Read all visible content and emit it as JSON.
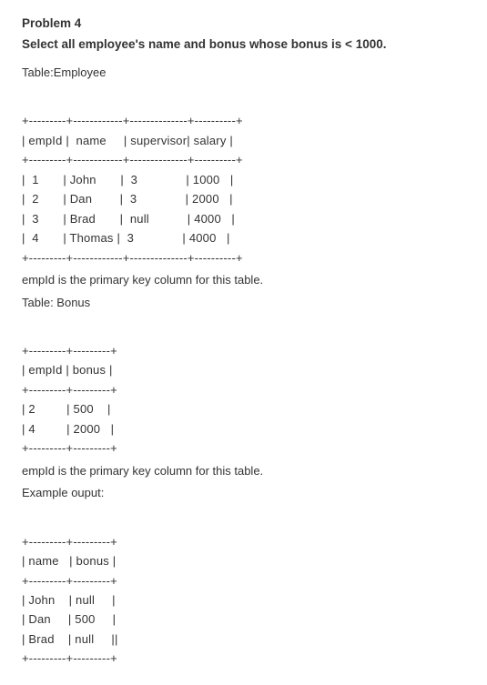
{
  "problem_title": "Problem 4",
  "problem_statement": "Select all employee's name and bonus whose bonus is < 1000.",
  "employee_table": {
    "label": "Table:Employee",
    "border": "+---------+------------+--------------+----------+",
    "header": "| empId |  name     | supervisor| salary |",
    "rows": [
      "|  1       | John       |  3              | 1000   |",
      "|  2       | Dan        |  3              | 2000   |",
      "|  3       | Brad       |  null           | 4000   |",
      "|  4       | Thomas |  3              | 4000   |"
    ],
    "note": "empId is the primary key column for this table."
  },
  "bonus_table": {
    "label": "Table: Bonus",
    "border": "+---------+---------+",
    "header": "| empId | bonus |",
    "rows": [
      "| 2         | 500    |",
      "| 4         | 2000   |"
    ],
    "note": "empId is the primary key column for this table."
  },
  "example_output": {
    "label": "Example ouput:",
    "border": "+---------+---------+",
    "header": "| name   | bonus |",
    "rows": [
      "| John    | null     |",
      "| Dan     | 500     |",
      "| Brad    | null     ||"
    ]
  },
  "chart_data": {
    "type": "table",
    "tables": [
      {
        "name": "Employee",
        "columns": [
          "empId",
          "name",
          "supervisor",
          "salary"
        ],
        "rows": [
          [
            1,
            "John",
            3,
            1000
          ],
          [
            2,
            "Dan",
            3,
            2000
          ],
          [
            3,
            "Brad",
            null,
            4000
          ],
          [
            4,
            "Thomas",
            3,
            4000
          ]
        ],
        "primary_key": "empId"
      },
      {
        "name": "Bonus",
        "columns": [
          "empId",
          "bonus"
        ],
        "rows": [
          [
            2,
            500
          ],
          [
            4,
            2000
          ]
        ],
        "primary_key": "empId"
      },
      {
        "name": "ExampleOutput",
        "columns": [
          "name",
          "bonus"
        ],
        "rows": [
          [
            "John",
            null
          ],
          [
            "Dan",
            500
          ],
          [
            "Brad",
            null
          ]
        ]
      }
    ]
  }
}
